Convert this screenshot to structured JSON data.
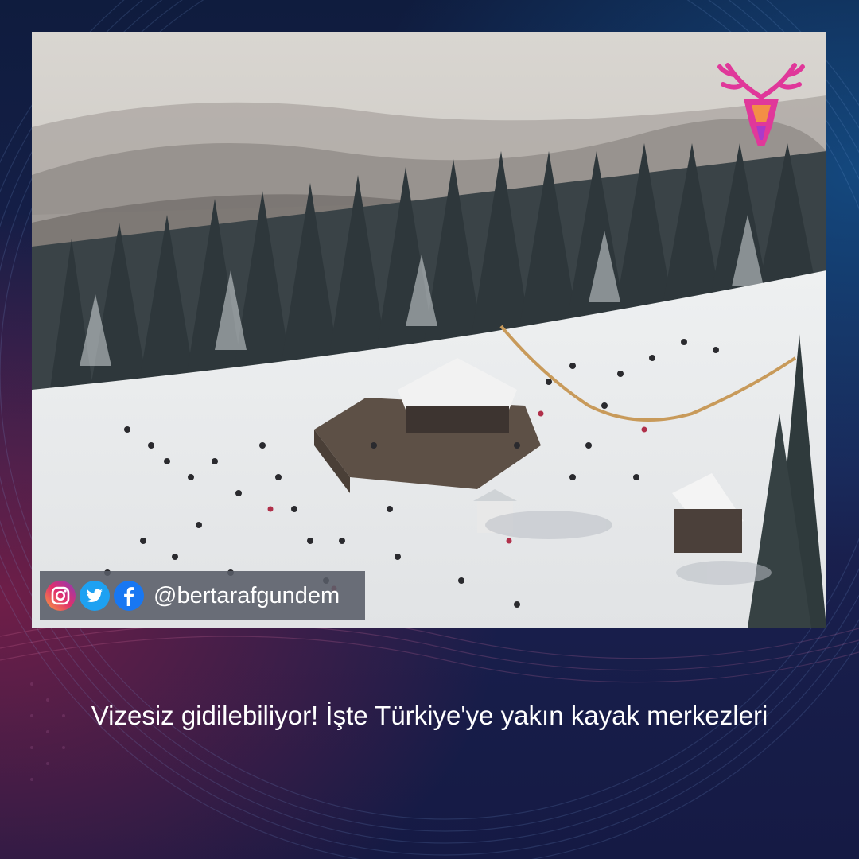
{
  "post": {
    "social_handle": "@bertarafgundem",
    "headline": "Vizesiz gidilebiliyor! İşte Türkiye'ye yakın kayak merkezleri"
  },
  "icons": {
    "logo": "deer-antler-logo",
    "social": [
      "instagram-icon",
      "twitter-icon",
      "facebook-icon"
    ]
  },
  "colors": {
    "background_dark": "#151a44",
    "background_magenta": "#8c1e46",
    "background_blue": "#145a96",
    "social_bar": "#585c68",
    "instagram": "#e1306c",
    "twitter": "#1da1f2",
    "facebook": "#1877f2",
    "logo_magenta": "#e0389a"
  }
}
